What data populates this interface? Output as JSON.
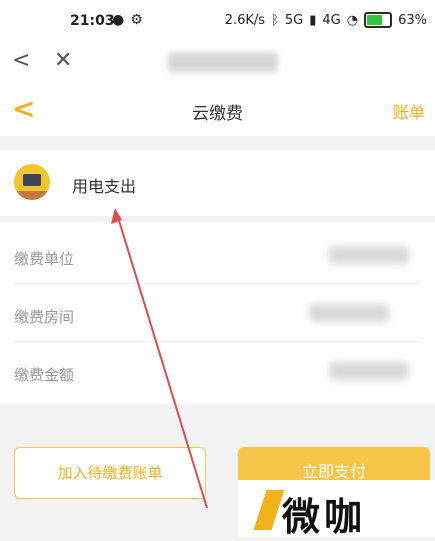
{
  "status_bar": {
    "time": "21:03",
    "speed": "2.6K/s",
    "signal_a": "5G",
    "signal_b": "4G",
    "battery": "63%"
  },
  "nav": {
    "back_icon": "chevron-left",
    "close_icon": "close-x"
  },
  "header": {
    "title": "云缴费",
    "right_link": "账单"
  },
  "service": {
    "name": "用电支出",
    "icon": "electricity-icon"
  },
  "form": {
    "rows": [
      {
        "label": "缴费单位"
      },
      {
        "label": "缴费房间"
      },
      {
        "label": "缴费金额"
      }
    ]
  },
  "actions": {
    "add_pending": "加入待缴费账单",
    "pay_now": "立即支付"
  },
  "watermark": {
    "text": "微咖"
  },
  "colors": {
    "accent": "#f2b21a",
    "button_fill": "#f7c54a"
  }
}
